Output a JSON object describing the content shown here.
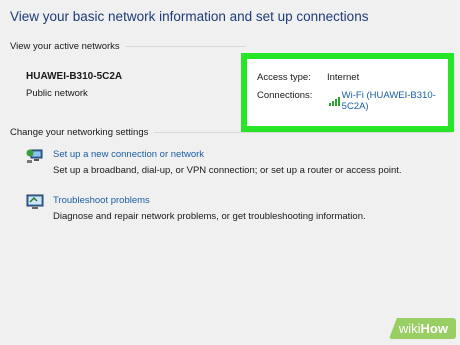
{
  "page_title": "View your basic network information and set up connections",
  "active_networks": {
    "header": "View your active networks",
    "network_name": "HUAWEI-B310-5C2A",
    "network_type": "Public network",
    "access_type_label": "Access type:",
    "access_type_value": "Internet",
    "connections_label": "Connections:",
    "connections_link": "Wi-Fi (HUAWEI-B310-5C2A)"
  },
  "change_settings": {
    "header": "Change your networking settings",
    "items": [
      {
        "icon": "network-setup-icon",
        "link": "Set up a new connection or network",
        "description": "Set up a broadband, dial-up, or VPN connection; or set up a router or access point."
      },
      {
        "icon": "troubleshoot-icon",
        "link": "Troubleshoot problems",
        "description": "Diagnose and repair network problems, or get troubleshooting information."
      }
    ]
  },
  "watermark": {
    "wiki": "wiki",
    "how": "How"
  },
  "colors": {
    "title": "#1e3a78",
    "link": "#1a5ea6",
    "highlight": "#27e527",
    "signal": "#2ea52e"
  }
}
